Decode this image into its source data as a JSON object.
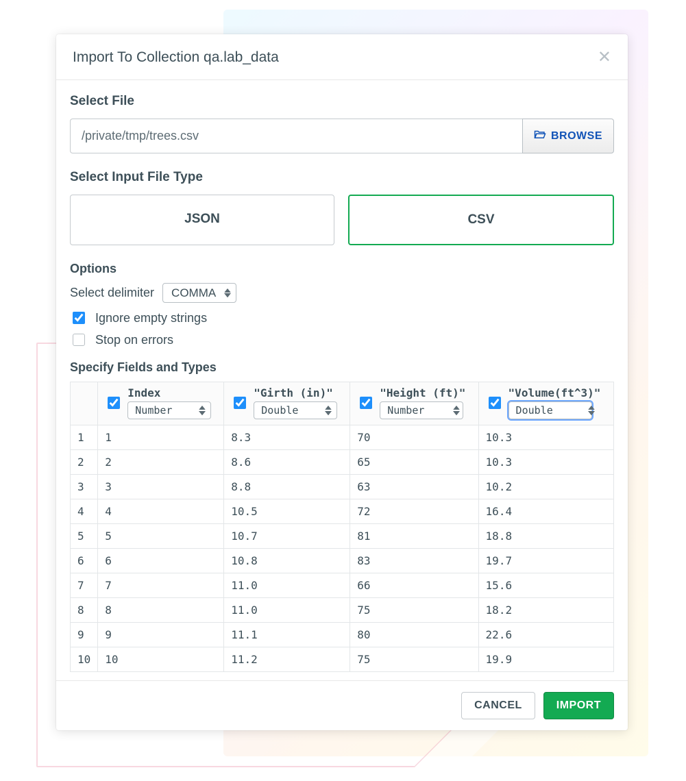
{
  "header": {
    "title": "Import To Collection qa.lab_data"
  },
  "file": {
    "section_label": "Select File",
    "path": "/private/tmp/trees.csv",
    "browse_label": "BROWSE"
  },
  "filetype": {
    "section_label": "Select Input File Type",
    "options": [
      "JSON",
      "CSV"
    ],
    "selected": "CSV"
  },
  "options": {
    "section_label": "Options",
    "delimiter_label": "Select delimiter",
    "delimiter_value": "COMMA",
    "ignore_empty": {
      "label": "Ignore empty strings",
      "checked": true
    },
    "stop_errors": {
      "label": "Stop on errors",
      "checked": false
    }
  },
  "fields": {
    "section_label": "Specify Fields and Types",
    "columns": [
      {
        "name": "Index",
        "quoted": false,
        "type": "Number",
        "checked": true
      },
      {
        "name": "\"Girth (in)\"",
        "quoted": true,
        "type": "Double",
        "checked": true
      },
      {
        "name": "\"Height (ft)\"",
        "quoted": true,
        "type": "Number",
        "checked": true
      },
      {
        "name": "\"Volume(ft^3)\"",
        "quoted": true,
        "type": "Double",
        "checked": true,
        "focused": true
      }
    ],
    "rows": [
      {
        "n": "1",
        "cells": [
          "1",
          "8.3",
          "70",
          "10.3"
        ]
      },
      {
        "n": "2",
        "cells": [
          "2",
          "8.6",
          "65",
          "10.3"
        ]
      },
      {
        "n": "3",
        "cells": [
          "3",
          "8.8",
          "63",
          "10.2"
        ]
      },
      {
        "n": "4",
        "cells": [
          "4",
          "10.5",
          "72",
          "16.4"
        ]
      },
      {
        "n": "5",
        "cells": [
          "5",
          "10.7",
          "81",
          "18.8"
        ]
      },
      {
        "n": "6",
        "cells": [
          "6",
          "10.8",
          "83",
          "19.7"
        ]
      },
      {
        "n": "7",
        "cells": [
          "7",
          "11.0",
          "66",
          "15.6"
        ]
      },
      {
        "n": "8",
        "cells": [
          "8",
          "11.0",
          "75",
          "18.2"
        ]
      },
      {
        "n": "9",
        "cells": [
          "9",
          "11.1",
          "80",
          "22.6"
        ]
      },
      {
        "n": "10",
        "cells": [
          "10",
          "11.2",
          "75",
          "19.9"
        ]
      }
    ]
  },
  "footer": {
    "cancel": "CANCEL",
    "import": "IMPORT"
  }
}
